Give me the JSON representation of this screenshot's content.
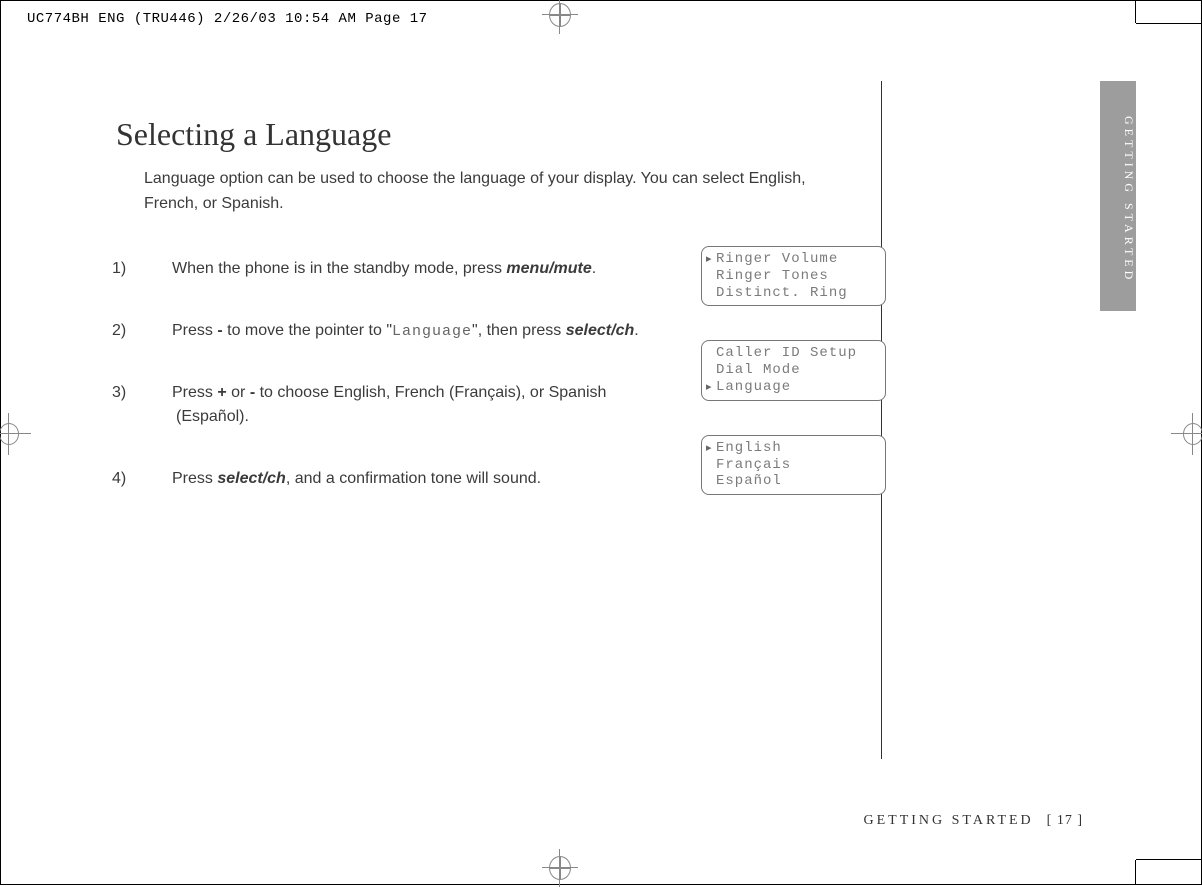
{
  "print_header": "UC774BH ENG (TRU446)  2/26/03  10:54 AM  Page 17",
  "side_tab": "GETTING STARTED",
  "title": "Selecting a Language",
  "intro": "Language option can be used to choose the language of your display. You can select English, French, or Spanish.",
  "steps": [
    {
      "num": "1)",
      "pre": "When the phone is in the standby mode, press ",
      "key": "menu/mute",
      "post": "."
    },
    {
      "num": "2)",
      "pre": "Press ",
      "minus": "-",
      "mid1": " to move the pointer to \"",
      "lcdword": "Language",
      "mid2": "\", then press ",
      "key": "select/ch",
      "post": "."
    },
    {
      "num": "3)",
      "pre": "Press ",
      "plus": "+",
      "mid1": " or ",
      "minus": "-",
      "post": " to choose English, French (Français), or Spanish (Español)."
    },
    {
      "num": "4)",
      "pre": "Press ",
      "key": "select/ch",
      "post": ", and a confirmation tone will sound."
    }
  ],
  "screens": [
    {
      "lines": [
        {
          "ptr": true,
          "text": "Ringer Volume"
        },
        {
          "ptr": false,
          "text": "Ringer Tones"
        },
        {
          "ptr": false,
          "text": "Distinct. Ring"
        }
      ]
    },
    {
      "lines": [
        {
          "ptr": false,
          "text": "Caller ID Setup"
        },
        {
          "ptr": false,
          "text": "Dial Mode"
        },
        {
          "ptr": true,
          "text": "Language"
        }
      ]
    },
    {
      "lines": [
        {
          "ptr": true,
          "text": "English"
        },
        {
          "ptr": false,
          "text": "Français"
        },
        {
          "ptr": false,
          "text": "Español"
        }
      ]
    }
  ],
  "footer_section": "GETTING STARTED",
  "footer_page": "[ 17 ]"
}
